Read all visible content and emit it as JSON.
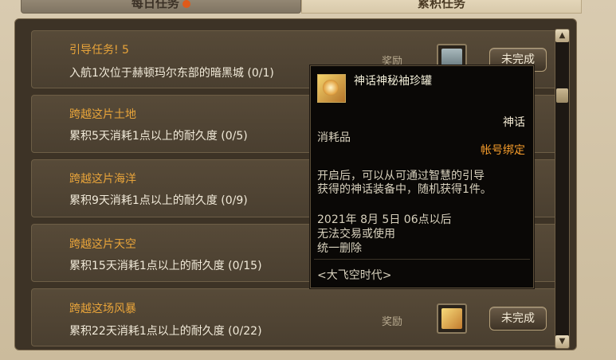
{
  "tabs": [
    {
      "label": "每日任务",
      "active": false
    },
    {
      "label": "累积任务",
      "active": true
    }
  ],
  "quests": [
    {
      "title": "引导任务! 5",
      "desc": "入航1次位于赫顿玛尔东部的暗黑城 (0/1)",
      "reward_label": "奖励",
      "status": "未完成"
    },
    {
      "title": "跨越这片土地",
      "desc": "累积5天消耗1点以上的耐久度 (0/5)",
      "reward_label": "",
      "status": ""
    },
    {
      "title": "跨越这片海洋",
      "desc": "累积9天消耗1点以上的耐久度 (0/9)",
      "reward_label": "",
      "status": ""
    },
    {
      "title": "跨越这片天空",
      "desc": "累积15天消耗1点以上的耐久度 (0/15)",
      "reward_label": "",
      "status": ""
    },
    {
      "title": "跨越这场风暴",
      "desc": "累积22天消耗1点以上的耐久度 (0/22)",
      "reward_label": "奖励",
      "status": "未完成"
    }
  ],
  "tooltip": {
    "name": "神话神秘袖珍罐",
    "rarity": "神话",
    "type": "消耗品",
    "bind": "帐号绑定",
    "desc_line1": "开启后，可以从可通过智慧的引导",
    "desc_line2": "获得的神话装备中，随机获得1件。",
    "trade_line1": "2021年 8月 5日 06点以后",
    "trade_line2": "无法交易或使用",
    "trade_line3": "统一删除",
    "source": "<大飞空时代>"
  },
  "icons": {
    "scroll_up": "triangle-up",
    "scroll_down": "triangle-down"
  },
  "colors": {
    "title": "#e8a43a",
    "bind": "#f59c2b",
    "text": "#f1ead9"
  }
}
